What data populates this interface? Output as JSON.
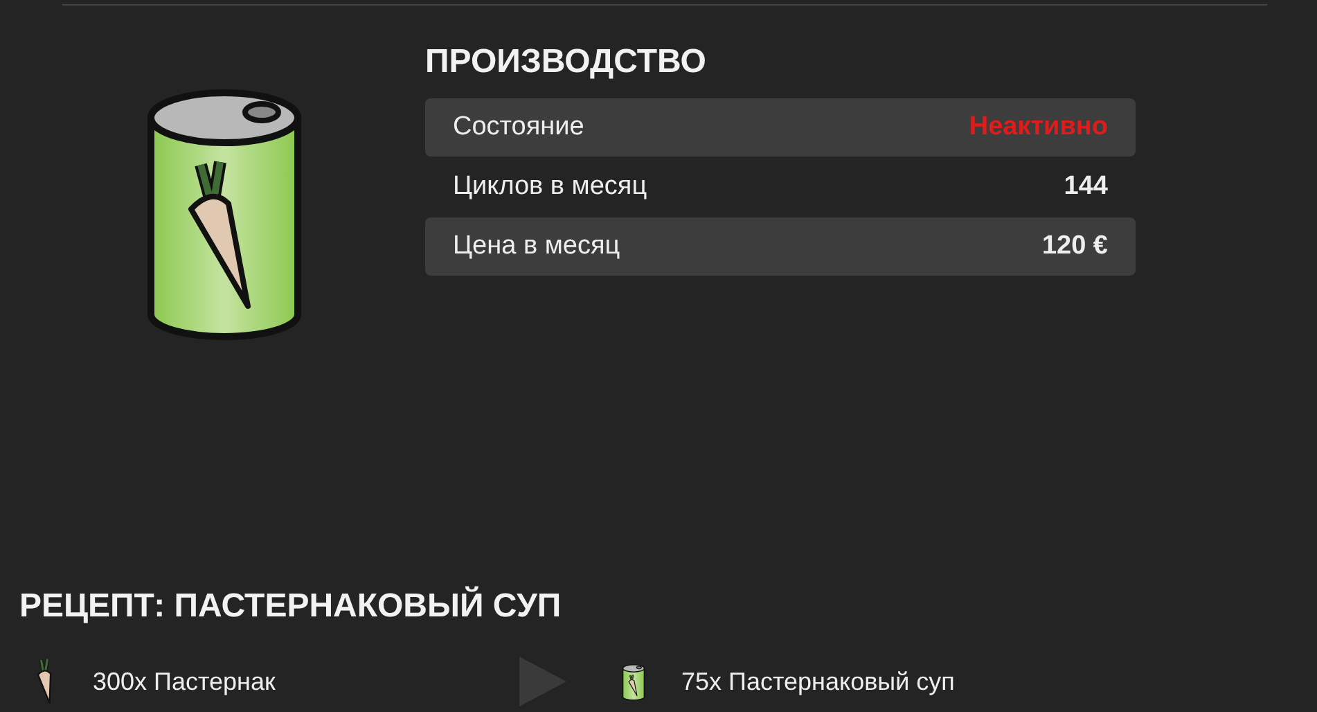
{
  "production": {
    "title": "ПРОИЗВОДСТВО",
    "rows": [
      {
        "kind": "status",
        "label": "Состояние",
        "value": "Неактивно",
        "active": false
      },
      {
        "kind": "plain",
        "label": "Циклов в месяц",
        "value": "144"
      },
      {
        "kind": "plain",
        "label": "Цена в месяц",
        "value": "120 €"
      }
    ]
  },
  "recipe": {
    "title": "РЕЦЕПТ: ПАСТЕРНАКОВЫЙ СУП",
    "inputs": [
      {
        "kind": "parsnip",
        "text": "300x Пастернак"
      }
    ],
    "outputs": [
      {
        "kind": "can",
        "text": "75x Пастернаковый суп"
      }
    ]
  }
}
